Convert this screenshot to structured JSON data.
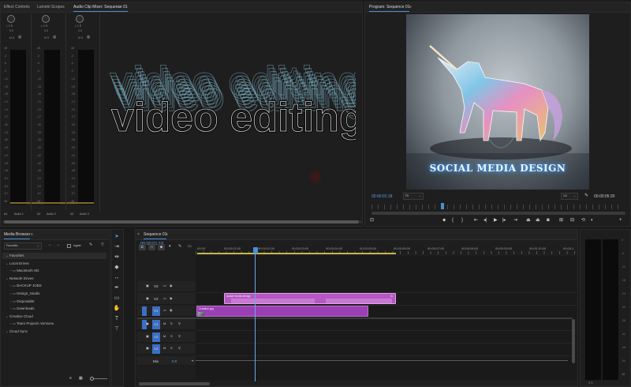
{
  "source_panel": {
    "tabs": [
      {
        "label": "Effect Controls"
      },
      {
        "label": "Lumetri Scopes"
      },
      {
        "label": "Audio Clip Mixer: Sequence 01"
      }
    ],
    "channels": [
      {
        "short": "A1",
        "name": "Audio 1"
      },
      {
        "short": "A2",
        "name": "Audio 2"
      },
      {
        "short": "A3",
        "name": "Audio 3"
      }
    ],
    "knob_label": "L  0  R",
    "knob_value": "0.0",
    "msr": "M  S  ",
    "db_scale": [
      "dB",
      "-3",
      "-6",
      "-9",
      "-12",
      "-15",
      "-18",
      "-21",
      "-24",
      "-27",
      "-30",
      "-33",
      "-36",
      "-39",
      "-42",
      "-45",
      "-48",
      "-51",
      "-54",
      "-57",
      "dB"
    ],
    "title_line1": "video editing",
    "title_line2": "video editing"
  },
  "program_panel": {
    "tab": "Program: Sequence 01",
    "frame_text": "SOCIAL MEDIA DESIGN",
    "timecode_current": "00:00:01:18",
    "fit": "Fit",
    "resolution": "1/2",
    "timecode_duration": "00:00:05:20"
  },
  "media_browser": {
    "tab": "Media Browser",
    "favorites_select": "Favorites",
    "ingest_label": "Ingest",
    "tree": [
      {
        "label": "Favorites",
        "level": 0
      },
      {
        "label": "Local Drives",
        "level": 0
      },
      {
        "label": "Macintosh HD",
        "level": 1
      },
      {
        "label": "Network Drives",
        "level": 0
      },
      {
        "label": "BACKUP JOBS",
        "level": 1
      },
      {
        "label": "Design_Studio",
        "level": 1
      },
      {
        "label": "Disposable",
        "level": 1
      },
      {
        "label": "Downloads",
        "level": 1
      },
      {
        "label": "Creative Cloud",
        "level": 0
      },
      {
        "label": "Team Projects Versions",
        "level": 1
      },
      {
        "label": "Cloud Sync",
        "level": 0
      }
    ]
  },
  "timeline": {
    "tab": "Sequence 01",
    "timecode": "00:00:01:18",
    "ruler": [
      ":00:00",
      "00:00:01:00",
      "00:00:02:00",
      "00:00:03:00",
      "00:00:04:00",
      "00:00:05:00",
      "00:00:06:00",
      "00:00:07:00",
      "00:00:08:00",
      "00:00:09:00",
      "00:00:10:00",
      "00:00:1"
    ],
    "video_tracks": [
      "V3",
      "V2",
      "V1"
    ],
    "audio_tracks": [
      "A1",
      "A2",
      "A3"
    ],
    "mix_label": "Mix",
    "mix_value": "0.0",
    "clip_v2": "social media design",
    "clip_v2_fx": "fx",
    "clip_v1": "Creative.jpg"
  },
  "right_meter": {
    "scale": [
      "0",
      "-6",
      "-12",
      "-18",
      "-24",
      "-30",
      "-36",
      "-42",
      "-48",
      "-54",
      "dB"
    ],
    "solo": "S  S"
  },
  "colors": {
    "accent_blue": "#4a8ed6",
    "clip_purple": "#9b3fb5",
    "clip_pink": "#b557c4",
    "track_blue": "#3b6fc4"
  }
}
